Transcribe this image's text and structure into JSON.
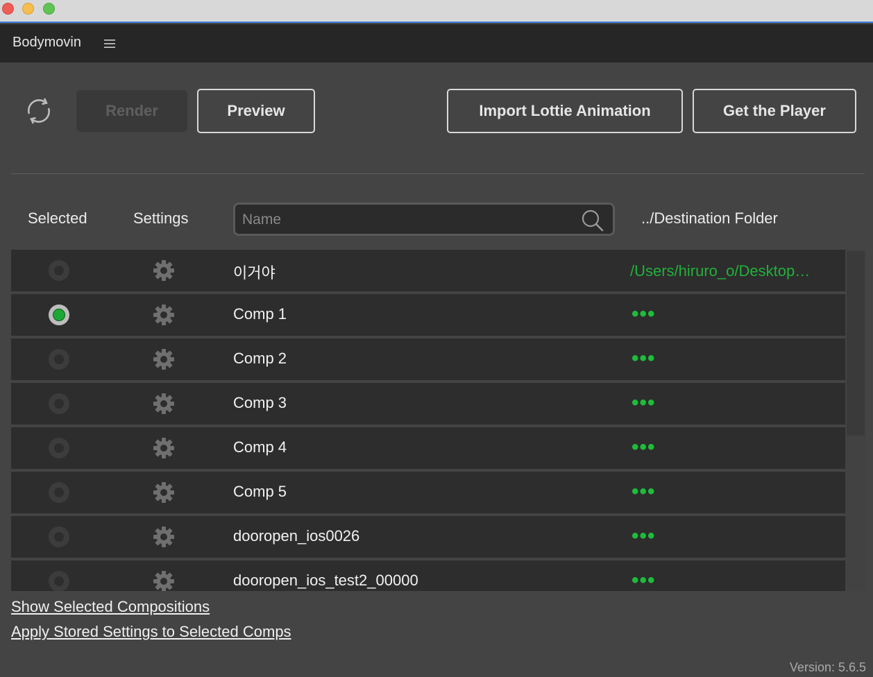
{
  "app": {
    "panel_title": "Bodymovin"
  },
  "toolbar": {
    "render_label": "Render",
    "preview_label": "Preview",
    "import_label": "Import Lottie Animation",
    "player_label": "Get the Player"
  },
  "headers": {
    "selected": "Selected",
    "settings": "Settings",
    "destination": "../Destination Folder"
  },
  "search": {
    "placeholder": "Name",
    "value": ""
  },
  "rows": [
    {
      "name": "이거야",
      "selected": false,
      "destination": "/Users/hiruro_o/Desktop…"
    },
    {
      "name": "Comp 1",
      "selected": true,
      "destination": "•••"
    },
    {
      "name": "Comp 2",
      "selected": false,
      "destination": "•••"
    },
    {
      "name": "Comp 3",
      "selected": false,
      "destination": "•••"
    },
    {
      "name": "Comp 4",
      "selected": false,
      "destination": "•••"
    },
    {
      "name": "Comp 5",
      "selected": false,
      "destination": "•••"
    },
    {
      "name": "dooropen_ios0026",
      "selected": false,
      "destination": "•••"
    },
    {
      "name": "dooropen_ios_test2_00000",
      "selected": false,
      "destination": "•••"
    }
  ],
  "footer": {
    "show_selected": "Show Selected Compositions",
    "apply_settings": "Apply Stored Settings to Selected Comps",
    "version": "Version: 5.6.5"
  },
  "colors": {
    "accent_green": "#21b13a",
    "panel_bg": "#444444",
    "row_bg": "#2d2d2d",
    "header_bar": "#262626"
  },
  "icons": {
    "refresh": "refresh-icon",
    "menu": "hamburger-menu-icon",
    "search": "search-icon",
    "settings": "gear-icon"
  }
}
